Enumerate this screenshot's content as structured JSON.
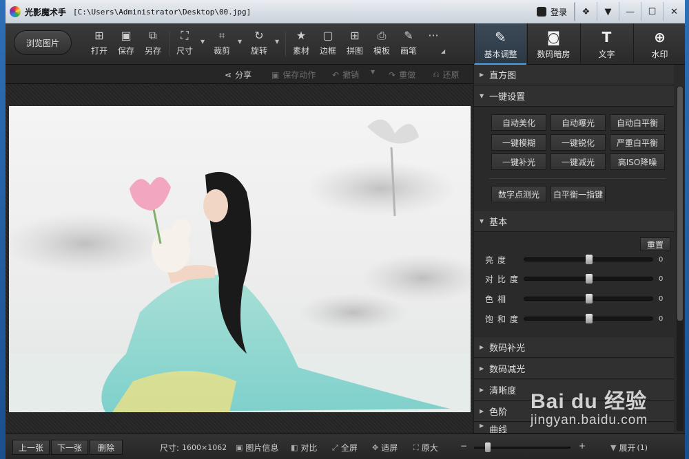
{
  "window": {
    "app_title": "光影魔术手",
    "path": "[C:\\Users\\Administrator\\Desktop\\00.jpg]",
    "login_label": "登录",
    "buttons": [
      "skin",
      "menu",
      "minimize",
      "maximize",
      "close"
    ]
  },
  "toolbar": {
    "browse_label": "浏览图片",
    "tools": [
      {
        "label": "打开",
        "icon": "open-image-icon"
      },
      {
        "label": "保存",
        "icon": "save-icon"
      },
      {
        "label": "另存",
        "icon": "save-as-icon"
      },
      {
        "label": "尺寸",
        "icon": "resize-icon"
      },
      {
        "label": "裁剪",
        "icon": "crop-icon"
      },
      {
        "label": "旋转",
        "icon": "rotate-icon"
      },
      {
        "label": "素材",
        "icon": "material-icon"
      },
      {
        "label": "边框",
        "icon": "border-icon"
      },
      {
        "label": "拼图",
        "icon": "collage-icon"
      },
      {
        "label": "模板",
        "icon": "template-icon"
      },
      {
        "label": "画笔",
        "icon": "brush-icon"
      }
    ],
    "more_label": "···",
    "mode_tabs": [
      {
        "label": "基本调整",
        "icon": "edit-icon",
        "active": true
      },
      {
        "label": "数码暗房",
        "icon": "camera-icon",
        "active": false
      },
      {
        "label": "文字",
        "icon": "text-icon",
        "active": false
      },
      {
        "label": "水印",
        "icon": "watermark-icon",
        "active": false
      }
    ]
  },
  "subbar": {
    "share": "分享",
    "save_action": "保存动作",
    "undo": "撤销",
    "redo": "重做",
    "restore": "还原"
  },
  "panel": {
    "histogram": "直方图",
    "one_click": "一键设置",
    "one_click_buttons": [
      "自动美化",
      "自动曝光",
      "自动白平衡",
      "一键模糊",
      "一键锐化",
      "严重白平衡",
      "一键补光",
      "一键减光",
      "高ISO降噪"
    ],
    "extra_buttons": [
      "数字点测光",
      "白平衡一指键"
    ],
    "basic": "基本",
    "reset": "重置",
    "sliders": [
      {
        "name": "亮度",
        "value": "0"
      },
      {
        "name": "对比度",
        "value": "0"
      },
      {
        "name": "色相",
        "value": "0"
      },
      {
        "name": "饱和度",
        "value": "0"
      }
    ],
    "more_sections": [
      "数码补光",
      "数码减光",
      "清晰度",
      "色阶",
      "曲线"
    ]
  },
  "bottom": {
    "prev": "上一张",
    "next": "下一张",
    "delete": "删除",
    "size_label": "尺寸:",
    "size_value": "1600×1062",
    "info": "图片信息",
    "compare": "对比",
    "fullscreen": "全屏",
    "fit": "适屏",
    "original": "原大",
    "expand": "展开",
    "expand_count": "(1)"
  },
  "watermark": {
    "big": "Bai du 经验",
    "small": "jingyan.baidu.com"
  }
}
